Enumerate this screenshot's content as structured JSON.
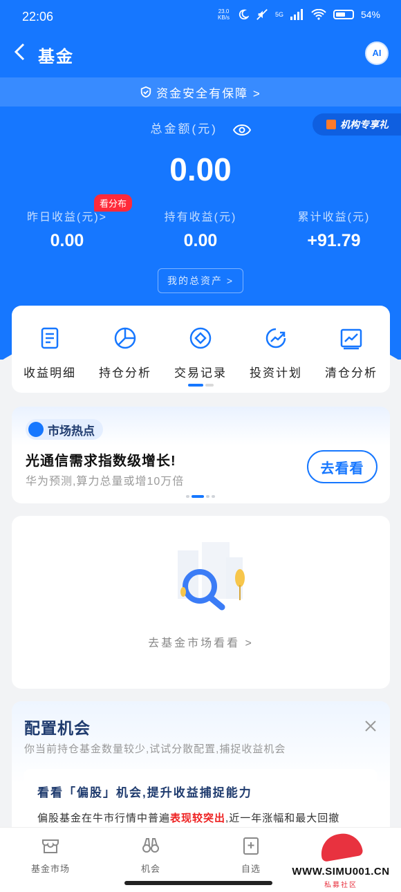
{
  "status": {
    "time": "22:06",
    "net_speed_value": "23.0",
    "net_speed_unit": "KB/s",
    "network": "5G",
    "battery": "54%"
  },
  "nav": {
    "title": "基金",
    "ai_label": "AI"
  },
  "safety_banner": "资金安全有保障 >",
  "institution_tag": "机构专享礼",
  "total": {
    "label": "总金额(元)",
    "value": "0.00"
  },
  "stats": [
    {
      "label": "昨日收益(元)>",
      "value": "0.00",
      "badge": "看分布"
    },
    {
      "label": "持有收益(元)",
      "value": "0.00"
    },
    {
      "label": "累计收益(元)",
      "value": "+91.79"
    }
  ],
  "my_assets_button": "我的总资产 >",
  "tools": [
    {
      "label": "收益明细",
      "icon": "document-icon"
    },
    {
      "label": "持仓分析",
      "icon": "pie-chart-icon"
    },
    {
      "label": "交易记录",
      "icon": "diamond-circle-icon"
    },
    {
      "label": "投资计划",
      "icon": "trend-up-icon"
    },
    {
      "label": "清仓分析",
      "icon": "line-chart-icon"
    }
  ],
  "market": {
    "tag": "市场热点",
    "title": "光通信需求指数级增长!",
    "subtitle": "华为预测,算力总量或增10万倍",
    "button": "去看看"
  },
  "empty_state": {
    "link": "去基金市场看看 >"
  },
  "config": {
    "title": "配置机会",
    "subtitle": "你当前持仓基金数量较少,试试分散配置,捕捉收益机会",
    "card_title": "看看「偏股」机会,提升收益捕捉能力",
    "card_text_before": "偏股基金在牛市行情中普遍",
    "card_text_highlight": "表现较突出",
    "card_text_after": ",近一年涨幅和最大回撤"
  },
  "tabbar": [
    {
      "label": "基金市场",
      "icon": "store-icon"
    },
    {
      "label": "机会",
      "icon": "binoculars-icon"
    },
    {
      "label": "自选",
      "icon": "add-favorite-icon"
    }
  ],
  "watermark": {
    "url": "WWW.SIMU001.CN",
    "caption": "私募社区"
  },
  "colors": {
    "primary": "#1677ff",
    "accent_red": "#ff2a3a"
  }
}
